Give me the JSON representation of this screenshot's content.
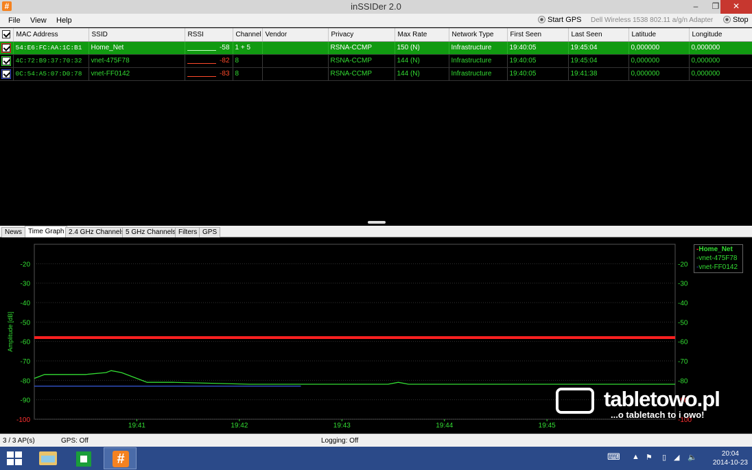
{
  "window": {
    "title": "inSSIDer 2.0"
  },
  "menu": [
    "File",
    "View",
    "Help"
  ],
  "toolbar": {
    "start_gps": "Start GPS",
    "adapter": "Dell Wireless 1538 802.11 a/g/n Adapter",
    "stop": "Stop"
  },
  "table": {
    "headers": [
      "MAC Address",
      "SSID",
      "RSSI",
      "Channel",
      "Vendor",
      "Privacy",
      "Max Rate",
      "Network Type",
      "First Seen",
      "Last Seen",
      "Latitude",
      "Longitude"
    ],
    "rows": [
      {
        "color": "#e52222",
        "mac": "54:E6:FC:AA:1C:B1",
        "ssid": "Home_Net",
        "rssi": "-58",
        "channel": "1 + 5",
        "vendor": "",
        "privacy": "RSNA-CCMP",
        "max_rate": "150 (N)",
        "network_type": "Infrastructure",
        "first_seen": "19:40:05",
        "last_seen": "19:45:04",
        "latitude": "0,000000",
        "longitude": "0,000000",
        "selected": true
      },
      {
        "color": "#33dd33",
        "mac": "4C:72:B9:37:70:32",
        "ssid": "vnet-475F78",
        "rssi": "-82",
        "channel": "8",
        "vendor": "",
        "privacy": "RSNA-CCMP",
        "max_rate": "144 (N)",
        "network_type": "Infrastructure",
        "first_seen": "19:40:05",
        "last_seen": "19:45:04",
        "latitude": "0,000000",
        "longitude": "0,000000",
        "selected": false
      },
      {
        "color": "#3344cc",
        "mac": "0C:54:A5:07:D0:78",
        "ssid": "vnet-FF0142",
        "rssi": "-83",
        "channel": "8",
        "vendor": "",
        "privacy": "RSNA-CCMP",
        "max_rate": "144 (N)",
        "network_type": "Infrastructure",
        "first_seen": "19:40:05",
        "last_seen": "19:41:38",
        "latitude": "0,000000",
        "longitude": "0,000000",
        "selected": false
      }
    ]
  },
  "tabs": [
    "News",
    "Time Graph",
    "2.4 GHz Channels",
    "5 GHz Channels",
    "Filters",
    "GPS"
  ],
  "active_tab": "Time Graph",
  "chart_data": {
    "type": "line",
    "ylabel": "Amplitude [dB]",
    "ylim": [
      -100,
      -10
    ],
    "yticks": [
      -20,
      -30,
      -40,
      -50,
      -60,
      -70,
      -80,
      -90,
      -100
    ],
    "xticks": [
      "19:41",
      "19:42",
      "19:43",
      "19:44",
      "19:45"
    ],
    "xlim_minutes": [
      19.0,
      25.25
    ],
    "grid": true,
    "legend": "top-right",
    "series": [
      {
        "name": "Home_Net",
        "color": "#ff2020",
        "bold": true,
        "x": [
          19.0,
          25.25
        ],
        "y": [
          -58,
          -58
        ]
      },
      {
        "name": "vnet-475F78",
        "color": "#33dd33",
        "x": [
          19.0,
          19.1,
          19.5,
          19.7,
          19.75,
          19.85,
          20.0,
          20.1,
          20.35,
          21.1,
          21.45,
          22.45,
          22.55,
          22.65,
          25.25
        ],
        "y": [
          -79,
          -77,
          -77,
          -76,
          -75,
          -76,
          -79,
          -81,
          -81,
          -82,
          -82,
          -82,
          -81,
          -82,
          -82
        ]
      },
      {
        "name": "vnet-FF0142",
        "color": "#3355cc",
        "x": [
          19.0,
          20.3,
          20.4,
          21.6
        ],
        "y": [
          -83,
          -83,
          -83,
          -83
        ]
      }
    ]
  },
  "status": {
    "ap_count": "3 / 3 AP(s)",
    "gps": "GPS: Off",
    "logging": "Logging: Off"
  },
  "watermark": {
    "brand": "tabletowo.pl",
    "tagline": "...o tabletach to i owo!"
  },
  "taskbar": {
    "time": "20:04",
    "date": "2014-10-23"
  }
}
